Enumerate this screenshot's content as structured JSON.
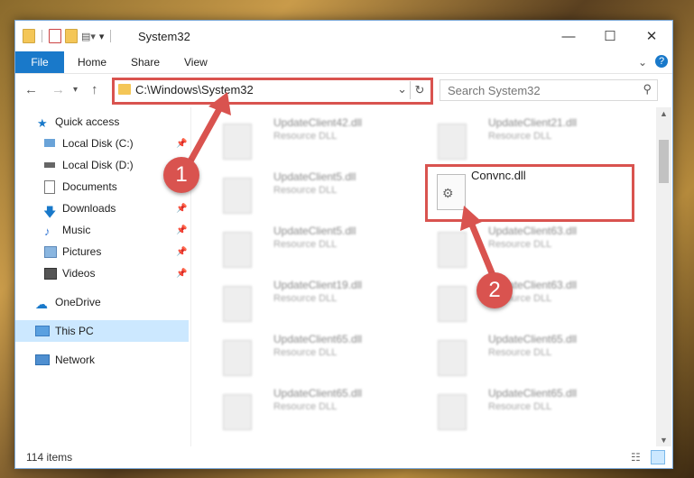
{
  "window": {
    "title": "System32",
    "controls": {
      "minimize": "—",
      "maximize": "☐",
      "close": "✕"
    }
  },
  "menu": {
    "file": "File",
    "home": "Home",
    "share": "Share",
    "view": "View",
    "help": "?",
    "expand": "⌄"
  },
  "address": {
    "path": "C:\\Windows\\System32"
  },
  "search": {
    "placeholder": "Search System32"
  },
  "sidebar": {
    "items": [
      {
        "label": "Quick access"
      },
      {
        "label": "Local Disk (C:)"
      },
      {
        "label": "Local Disk (D:)"
      },
      {
        "label": "Documents"
      },
      {
        "label": "Downloads"
      },
      {
        "label": "Music"
      },
      {
        "label": "Pictures"
      },
      {
        "label": "Videos"
      },
      {
        "label": "OneDrive"
      },
      {
        "label": "This PC"
      },
      {
        "label": "Network"
      }
    ]
  },
  "files": [
    {
      "name": "UpdateClient42.dll",
      "type": "Resource DLL"
    },
    {
      "name": "UpdateClient21.dll",
      "type": "Resource DLL"
    },
    {
      "name": "UpdateClient5.dll",
      "type": "Resource DLL"
    },
    {
      "name": "Convnc.dll",
      "type": ""
    },
    {
      "name": "UpdateClient5.dll",
      "type": "Resource DLL"
    },
    {
      "name": "UpdateClient63.dll",
      "type": "Resource DLL"
    },
    {
      "name": "UpdateClient19.dll",
      "type": "Resource DLL"
    },
    {
      "name": "UpdateClient63.dll",
      "type": "Resource DLL"
    },
    {
      "name": "UpdateClient65.dll",
      "type": "Resource DLL"
    },
    {
      "name": "UpdateClient65.dll",
      "type": "Resource DLL"
    },
    {
      "name": "UpdateClient65.dll",
      "type": "Resource DLL"
    },
    {
      "name": "UpdateClient65.dll",
      "type": "Resource DLL"
    }
  ],
  "status": {
    "count": "114 items"
  },
  "callouts": {
    "one": "1",
    "two": "2"
  },
  "colors": {
    "accent": "#1979ca",
    "highlight": "#d9534f"
  }
}
